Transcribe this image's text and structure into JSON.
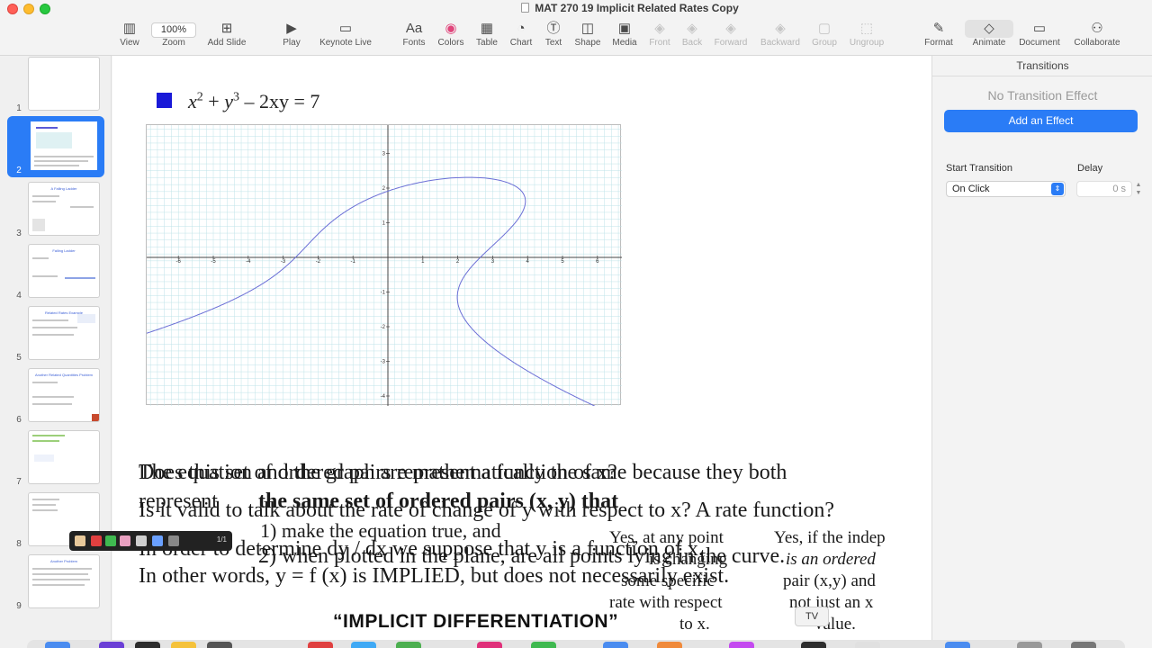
{
  "window": {
    "title": "MAT 270 19 Implicit Related Rates Copy"
  },
  "toolbar": {
    "view": "View",
    "zoom_value": "100%",
    "zoom": "Zoom",
    "add_slide": "Add Slide",
    "play": "Play",
    "keynote_live": "Keynote Live",
    "fonts": "Fonts",
    "colors": "Colors",
    "table": "Table",
    "chart": "Chart",
    "text": "Text",
    "shape": "Shape",
    "media": "Media",
    "front": "Front",
    "back": "Back",
    "forward": "Forward",
    "backward": "Backward",
    "group": "Group",
    "ungroup": "Ungroup",
    "format": "Format",
    "animate": "Animate",
    "document": "Document",
    "collaborate": "Collaborate",
    "fonts_icon_text": "Aa"
  },
  "navigator": {
    "slides": [
      {
        "number": "1",
        "title": ""
      },
      {
        "number": "2",
        "title": ""
      },
      {
        "number": "3",
        "title": "A Falling Ladder"
      },
      {
        "number": "4",
        "title": "Falling Ladder"
      },
      {
        "number": "5",
        "title": "Related Rates Example"
      },
      {
        "number": "6",
        "title": "Another Related Quantities Problem"
      },
      {
        "number": "7",
        "title": ""
      },
      {
        "number": "8",
        "title": ""
      },
      {
        "number": "9",
        "title": "Another Problem"
      }
    ],
    "selected": "2"
  },
  "slide": {
    "equation": {
      "x": "x",
      "exp_x": "2",
      "plus": " + ",
      "y": "y",
      "exp_y": "3",
      "rest": " – 2xy  =  7"
    },
    "graph": {
      "x_ticks": [
        "-6",
        "-5",
        "-4",
        "-3",
        "-2",
        "-1",
        "1",
        "2",
        "3",
        "4",
        "5",
        "6"
      ],
      "y_ticks": [
        "3",
        "2",
        "1",
        "-1",
        "-2",
        "-3",
        "-4"
      ]
    },
    "overlapping_text": {
      "line1a": "Does this set of ordered pairs represent a function of x?",
      "line1b": "The equation and the graph are mathematically the same because they both",
      "line2a": "represent",
      "line2b": "the same set of ordered pairs (x, y) that",
      "line2c": "Is it valid to talk about the rate of change of y with respect to x? A rate function?",
      "line3a": "1) make the equation true, and",
      "line4a": "In order to determine dy / dx we suppose that y is a function of x.",
      "line4b": "2) when plotted in the plane, are all points lying in the curve.",
      "line5a": "In other words, y = f (x) is IMPLIED, but does not necessarily exist."
    },
    "side_notes": {
      "left_1": "Yes, at any point",
      "left_2": "some specific",
      "left_3": "rate with respect",
      "left_4": "to x.",
      "left_extra": "is changing",
      "right_1": "Yes, if the indep",
      "right_2": "is an ordered",
      "right_3": "pair (x,y) and",
      "right_4": "not just an x",
      "right_5": "value."
    },
    "big_title": "“IMPLICIT DIFFERENTIATION”",
    "tv_badge": "TV",
    "pen_counter": "1/1"
  },
  "inspector": {
    "tab": "Transitions",
    "no_effect": "No Transition Effect",
    "add_effect": "Add an Effect",
    "start_label": "Start Transition",
    "start_value": "On Click",
    "delay_label": "Delay",
    "delay_value": "0 s"
  },
  "colors": {
    "accent": "#2a7cf6",
    "curve": "#6b6fd6",
    "grid": "#bfe3e8",
    "bullet": "#1a1ad8"
  }
}
